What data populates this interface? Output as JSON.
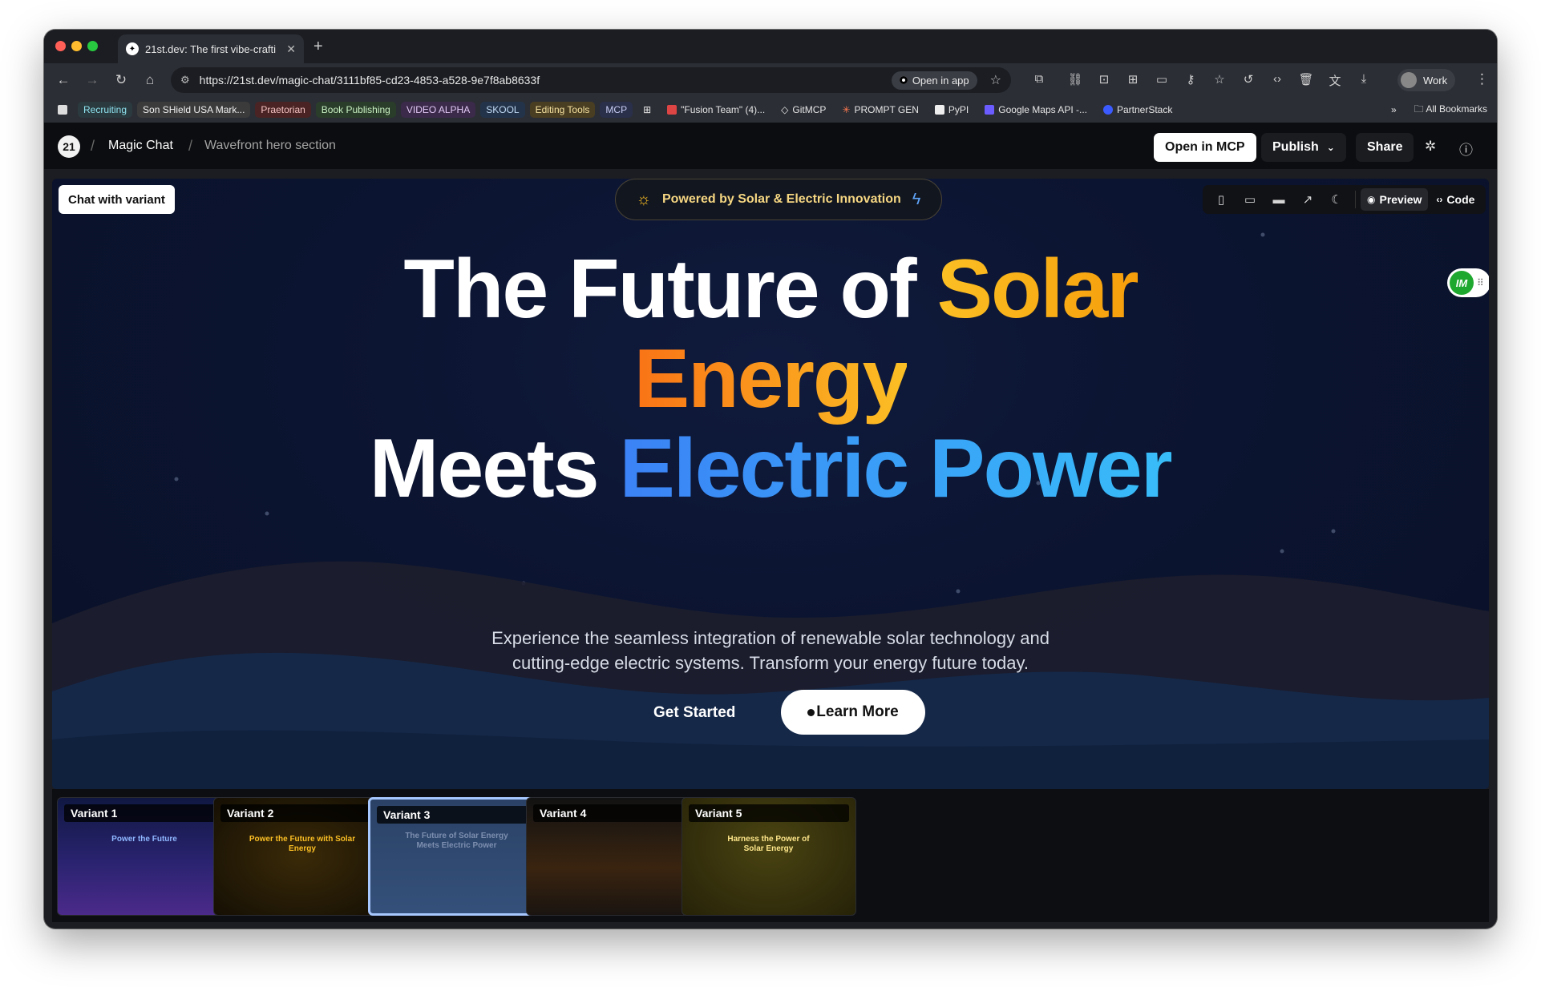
{
  "browser": {
    "tab_title": "21st.dev: The first vibe-crafti",
    "url": "https://21st.dev/magic-chat/3111bf85-cd23-4853-a528-9e7f8ab8633f",
    "open_in_app": "Open in app",
    "profile": "Work",
    "bookmarks": [
      {
        "label": "Recruiting",
        "bg": "#2a3a3e",
        "color": "#8fe3f0"
      },
      {
        "label": "Son SHield USA Mark...",
        "bg": "#3b3b3b",
        "color": "#f0f0f0"
      },
      {
        "label": "Praetorian",
        "bg": "#4a2424",
        "color": "#f5c2c2"
      },
      {
        "label": "Book Publishing",
        "bg": "#2a3d2a",
        "color": "#c9f0c2"
      },
      {
        "label": "VIDEO ALPHA",
        "bg": "#3b2a4a",
        "color": "#e2c9f5"
      },
      {
        "label": "SKOOL",
        "bg": "#23344a",
        "color": "#c2daf5"
      },
      {
        "label": "Editing Tools",
        "bg": "#4a3e22",
        "color": "#f5e2a0"
      },
      {
        "label": "MCP",
        "bg": "#2a2f4a",
        "color": "#c9cff5"
      }
    ],
    "bookmark_links": [
      "\"Fusion Team\" (4)...",
      "GitMCP",
      "PROMPT GEN",
      "PyPI",
      "Google Maps API -...",
      "PartnerStack"
    ],
    "all_bookmarks": "All Bookmarks"
  },
  "app": {
    "logo": "21",
    "crumb_project": "Magic Chat",
    "crumb_page": "Wavefront hero section",
    "open_in_mcp": "Open in MCP",
    "publish": "Publish",
    "share": "Share"
  },
  "preview": {
    "chat_with_variant": "Chat with variant",
    "pill": "Powered by Solar & Electric Innovation",
    "preview_tab": "Preview",
    "code_tab": "Code",
    "im_badge": "IM",
    "hero": {
      "line1_a": "The Future of ",
      "line1_b": "Solar",
      "line2": "Energy",
      "line3_a": "Meets ",
      "line3_b": "Electric Power"
    },
    "subtitle_1": "Experience the seamless integration of renewable solar technology and",
    "subtitle_2": "cutting-edge electric systems. Transform your energy future today.",
    "cta_primary": "Get Started",
    "cta_secondary": "Learn More"
  },
  "variants": [
    {
      "label": "Variant 1",
      "title": "Power the Future",
      "selected": false
    },
    {
      "label": "Variant 2",
      "title": "Power the Future with Solar Energy",
      "selected": false
    },
    {
      "label": "Variant 3",
      "title": "The Future of Solar Energy Meets Electric Power",
      "selected": true
    },
    {
      "label": "Variant 4",
      "title": "",
      "selected": false
    },
    {
      "label": "Variant 5",
      "title": "Harness the Power of Solar Energy",
      "selected": false
    }
  ],
  "colors": {
    "solar": "#fbbf24",
    "energy": "#f97316",
    "electric": "#3b82f6",
    "selected_border": "#a7c7ff"
  }
}
